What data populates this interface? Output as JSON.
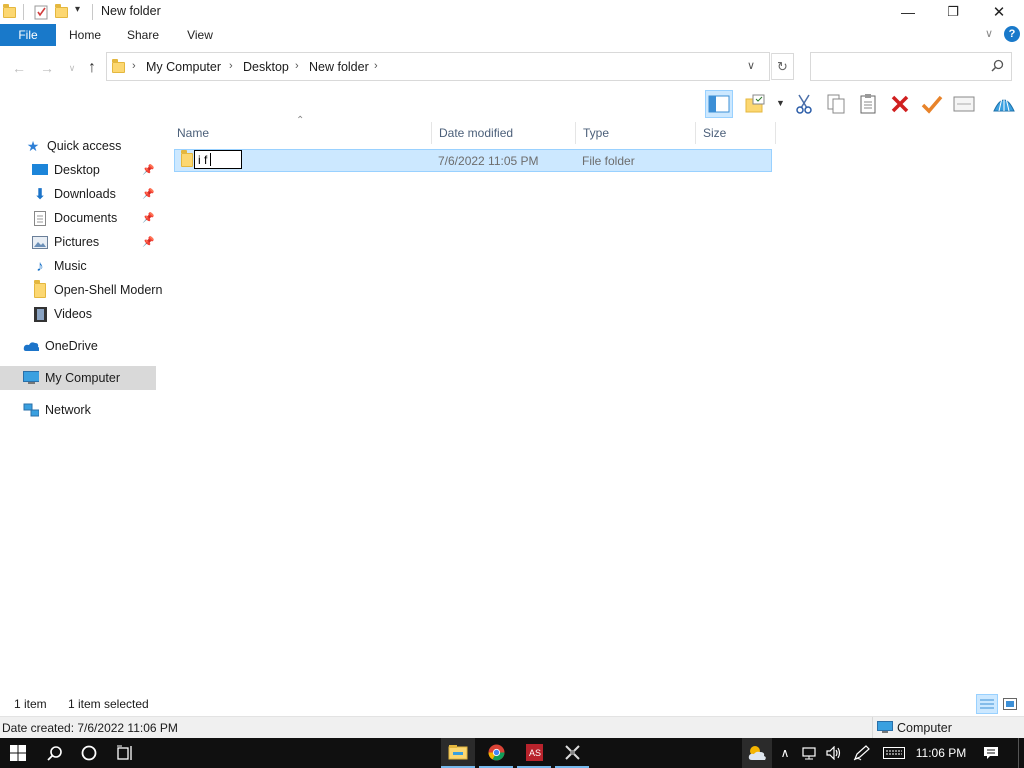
{
  "window": {
    "title": "New folder",
    "minimize_glyph": "—",
    "restore_glyph": "❐",
    "close_glyph": "✕"
  },
  "ribbon": {
    "tabs": [
      {
        "label": "File"
      },
      {
        "label": "Home"
      },
      {
        "label": "Share"
      },
      {
        "label": "View"
      }
    ],
    "help_glyph": "?"
  },
  "address": {
    "breadcrumbs": [
      {
        "label": "My Computer"
      },
      {
        "label": "Desktop"
      },
      {
        "label": "New folder"
      }
    ],
    "search_placeholder": ""
  },
  "navpane": {
    "quick_access": "Quick access",
    "items": [
      {
        "label": "Desktop",
        "icon": "desktop-icon",
        "pinned": true
      },
      {
        "label": "Downloads",
        "icon": "download-icon",
        "pinned": true
      },
      {
        "label": "Documents",
        "icon": "document-icon",
        "pinned": true
      },
      {
        "label": "Pictures",
        "icon": "picture-icon",
        "pinned": true
      },
      {
        "label": "Music",
        "icon": "music-icon",
        "pinned": false
      },
      {
        "label": "Open-Shell Modern",
        "icon": "folder-icon",
        "pinned": false
      },
      {
        "label": "Videos",
        "icon": "video-icon",
        "pinned": false
      }
    ],
    "onedrive": "OneDrive",
    "my_computer": "My Computer",
    "network": "Network"
  },
  "filelist": {
    "columns": [
      "Name",
      "Date modified",
      "Type",
      "Size"
    ],
    "rows": [
      {
        "name_edit_value": "i f",
        "date": "7/6/2022 11:05 PM",
        "type": "File folder",
        "size": ""
      }
    ]
  },
  "status": {
    "item_count": "1 item",
    "selected": "1 item selected",
    "details": "Date created: 7/6/2022 11:06 PM",
    "location": "Computer"
  },
  "taskbar": {
    "time": "11:06 PM"
  },
  "colors": {
    "accent": "#1979ca",
    "selection": "#cce8ff",
    "selection_border": "#99d1ff",
    "taskbar": "#101010",
    "folder": "#fcd771"
  }
}
